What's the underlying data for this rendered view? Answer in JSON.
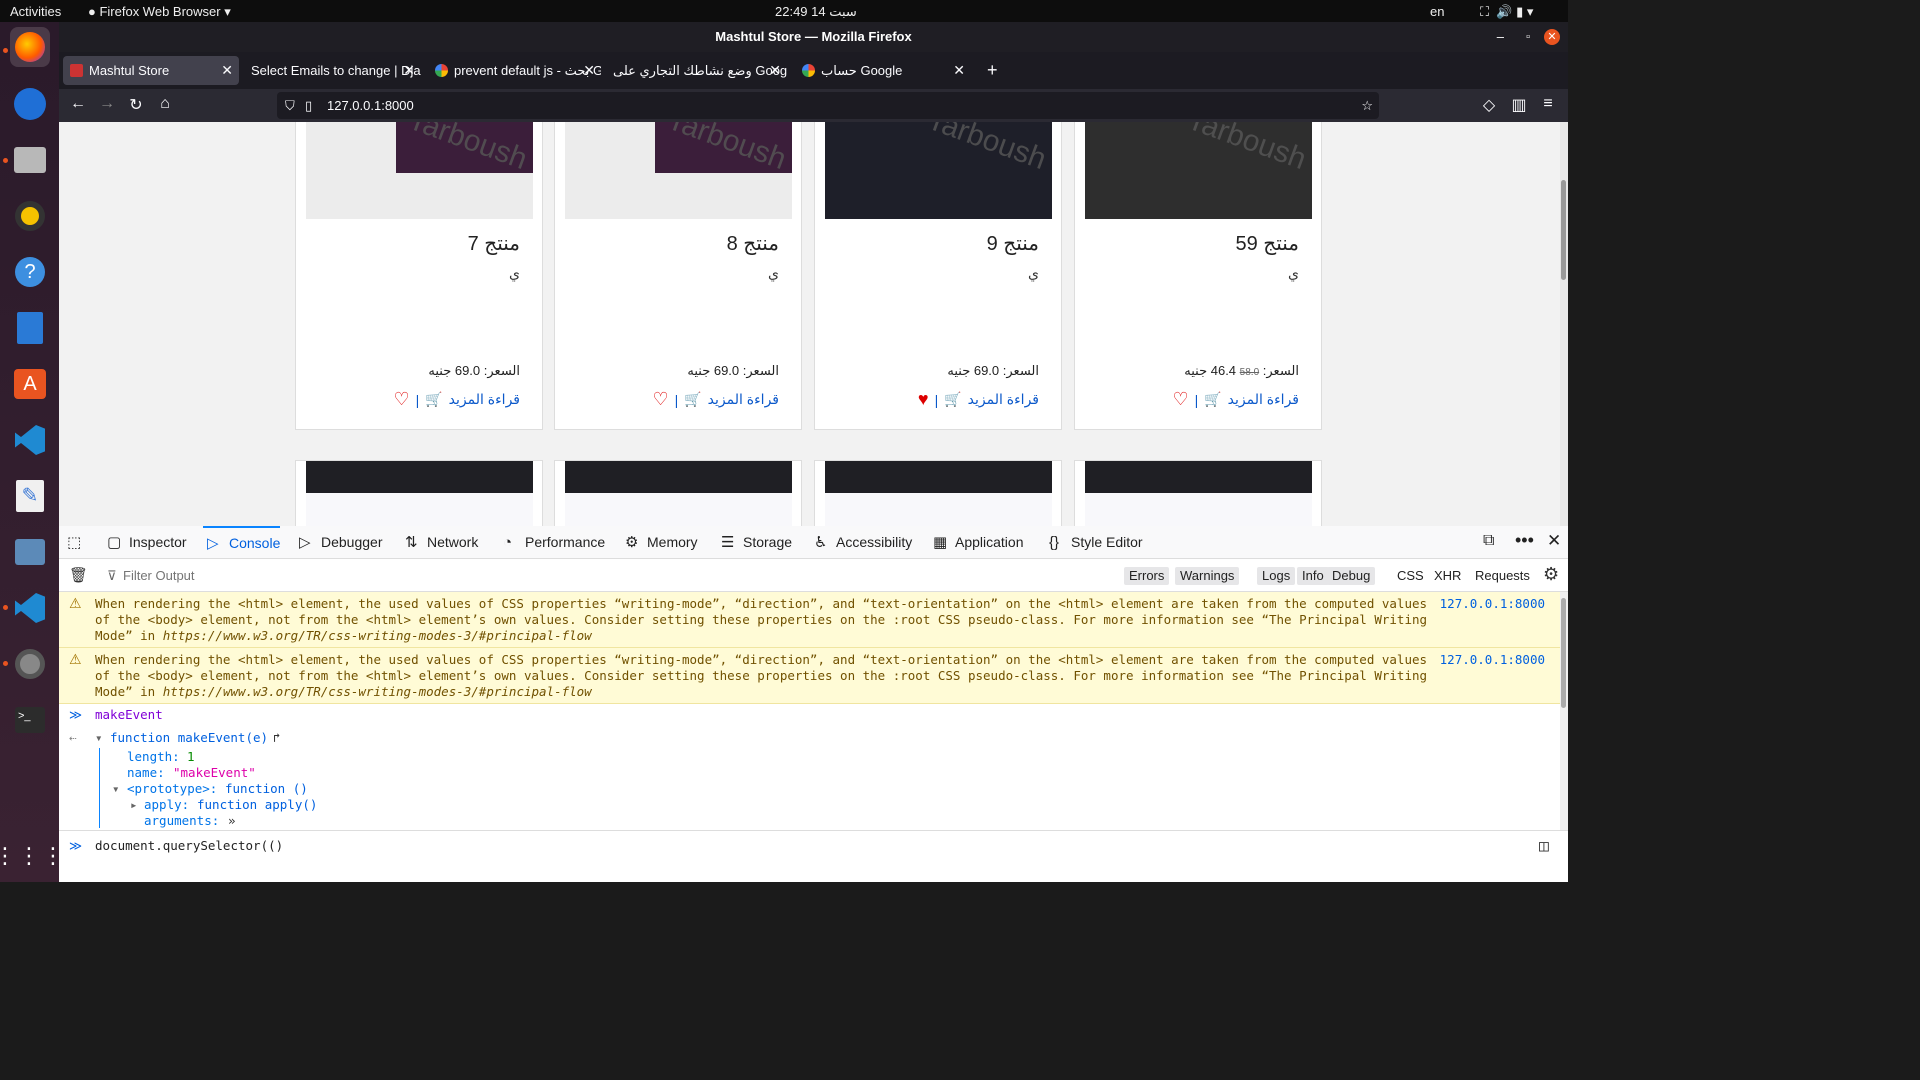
{
  "topbar": {
    "activities": "Activities",
    "app_menu": "Firefox Web Browser",
    "clock": "22:49  14 سبت",
    "lang": "en"
  },
  "window": {
    "title": "Mashtul Store — Mozilla Firefox"
  },
  "tabs": [
    {
      "label": "Mashtul Store",
      "active": true
    },
    {
      "label": "Select Emails to change | Dja"
    },
    {
      "label": "prevent default js - بحث G"
    },
    {
      "label": "وضع نشاطك التجاري على Google"
    },
    {
      "label": "حساب Google"
    }
  ],
  "url": "127.0.0.1:8000",
  "products": [
    {
      "name": "منتج 59",
      "desc": "ي",
      "price": "السعر:",
      "old_price": "58.0",
      "new_price": "46.4 جنيه",
      "read_more": "قراءة المزيد",
      "liked": false,
      "wm": "Tarboush"
    },
    {
      "name": "منتج 9",
      "desc": "ي",
      "price": "السعر: 69.0 جنيه",
      "read_more": "قراءة المزيد",
      "liked": true,
      "wm": "Tarboush"
    },
    {
      "name": "منتج 8",
      "desc": "ي",
      "price": "السعر: 69.0 جنيه",
      "read_more": "قراءة المزيد",
      "liked": false,
      "wm": "Tarboush"
    },
    {
      "name": "منتج 7",
      "desc": "ي",
      "price": "السعر: 69.0 جنيه",
      "read_more": "قراءة المزيد",
      "liked": false,
      "wm": "Tarboush"
    }
  ],
  "devtools": {
    "tabs": [
      "Inspector",
      "Console",
      "Debugger",
      "Network",
      "Performance",
      "Memory",
      "Storage",
      "Accessibility",
      "Application",
      "Style Editor"
    ],
    "filter_placeholder": "Filter Output",
    "levels": [
      "Errors",
      "Warnings",
      "Logs",
      "Info",
      "Debug"
    ],
    "types": [
      "CSS",
      "XHR",
      "Requests"
    ]
  },
  "console": {
    "warnings": [
      {
        "text": "When rendering the <html> element, the used values of CSS properties “writing-mode”, “direction”, and “text-orientation” on the <html> element are taken from the computed values of the <body> element, not from the <html> element’s own values. Consider setting these properties on the :root CSS pseudo-class. For more information see “The Principal Writing Mode” in ",
        "link": "https://www.w3.org/TR/css-writing-modes-3/#principal-flow",
        "source": "127.0.0.1:8000"
      },
      {
        "text": "When rendering the <html> element, the used values of CSS properties “writing-mode”, “direction”, and “text-orientation” on the <html> element are taken from the computed values of the <body> element, not from the <html> element’s own values. Consider setting these properties on the :root CSS pseudo-class. For more information see “The Principal Writing Mode” in ",
        "link": "https://www.w3.org/TR/css-writing-modes-3/#principal-flow",
        "source": "127.0.0.1:8000"
      }
    ],
    "input_echo": "makeEvent",
    "result_head": "function makeEvent(e)",
    "props": {
      "length_key": "length:",
      "length_val": "1",
      "name_key": "name:",
      "name_val": "\"makeEvent\"",
      "proto_key": "<prototype>:",
      "proto_val": "function ()",
      "apply_key": "apply:",
      "apply_val": "function apply()",
      "args_key": "arguments:",
      "args_val": "»"
    },
    "current_input": "document.querySelector(()"
  }
}
